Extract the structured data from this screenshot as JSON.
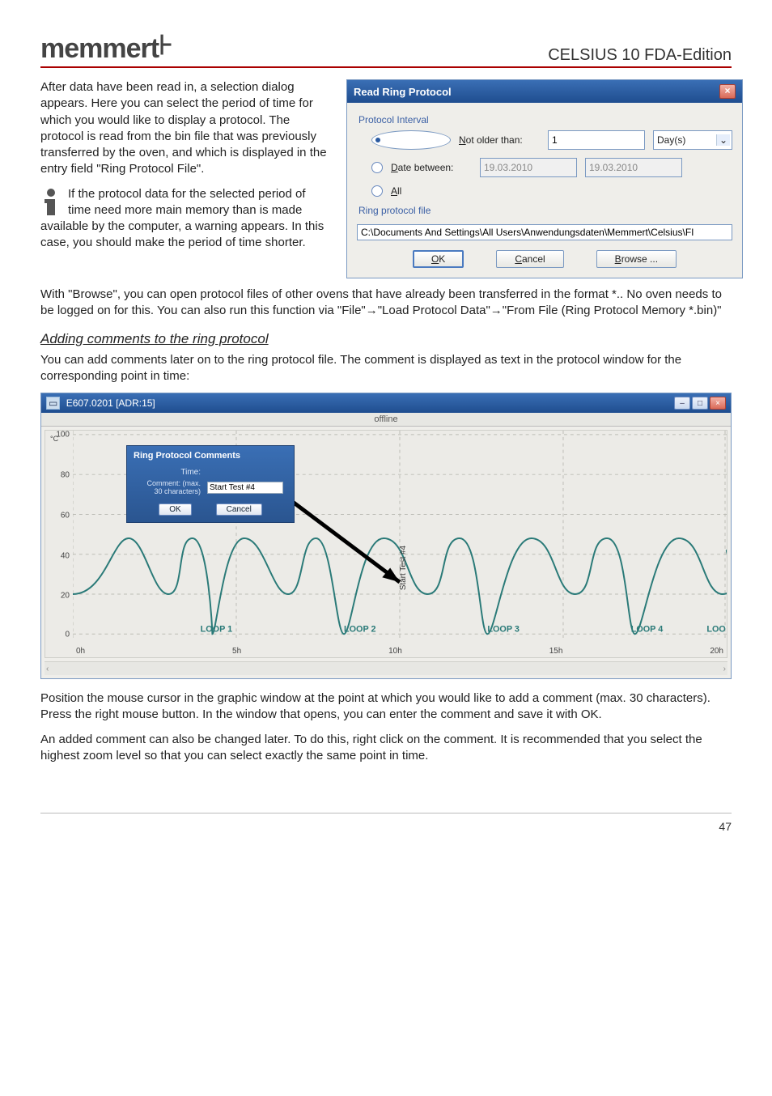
{
  "header": {
    "logo_text": "memmert",
    "doc_title": "CELSIUS 10 FDA-Edition"
  },
  "intro_para": "After data have been read in, a selection dialog appears. Here you can select the period of time for which you would like to display a protocol. The protocol is read from the bin file that was previously transferred by the oven, and which is displayed in the entry field \"Ring Protocol File\".",
  "info_para": "If the protocol data for the selected period of time need more main memory than is made available by the computer, a warning appears. In this case, you should make the period of time shorter.",
  "dialog": {
    "title": "Read Ring Protocol",
    "group1": "Protocol Interval",
    "opt1_label": "Not older than:",
    "opt1_value": "1",
    "opt1_unit": "Day(s)",
    "opt2_label": "Date between:",
    "opt2_from": "19.03.2010",
    "opt2_to": "19.03.2010",
    "opt3_label": "All",
    "group2": "Ring protocol file",
    "path_value": "C:\\Documents And Settings\\All Users\\Anwendungsdaten\\Memmert\\Celsius\\FI",
    "btn_ok": "OK",
    "btn_cancel": "Cancel",
    "btn_browse": "Browse ..."
  },
  "mid_para": "With \"Browse\", you can open protocol files of other ovens that have already been transferred in the format *.. No oven needs to be logged on for this. You can also run this function via \"File\"→\"Load Protocol Data\"→\"From File (Ring Protocol Memory *.bin)\"",
  "section_head": "Adding comments to the ring protocol",
  "section_para": "You can add comments later on to the ring protocol file. The comment is displayed as text in the protocol window for the corresponding point in time:",
  "chart_window": {
    "title": "E607.0201 [ADR:15]",
    "tab": "offline",
    "comment_box": {
      "header": "Ring Protocol Comments",
      "time_label": "Time:",
      "comment_label": "Comment: (max. 30 characters)",
      "comment_value": "Start Test #4",
      "ok": "OK",
      "cancel": "Cancel"
    },
    "annotation": "Start Test #4",
    "loops": [
      "LOOP 1",
      "LOOP 2",
      "LOOP 3",
      "LOOP 4",
      "LOOP"
    ]
  },
  "chart_data": {
    "type": "line",
    "title": "",
    "xlabel": "",
    "ylabel": "°C",
    "ylim": [
      0,
      100
    ],
    "x_ticks": [
      "0h",
      "5h",
      "10h",
      "15h",
      "20h"
    ],
    "y_ticks": [
      0,
      20,
      40,
      60,
      80,
      100
    ],
    "series_note": "Repeating loop profile ~5 cycles between ~20°C and ~50°C shown as teal trace"
  },
  "para_after_chart_1": "Position the mouse cursor in the graphic window at the point at which you would like to add a comment (max. 30 characters). Press the right mouse button. In the window that opens, you can enter the comment and save it with OK.",
  "para_after_chart_2": "An added comment can also be changed later. To do this, right click on the comment. It is recommended that you select the highest zoom level so that you can select exactly the same point in time.",
  "page_number": "47"
}
